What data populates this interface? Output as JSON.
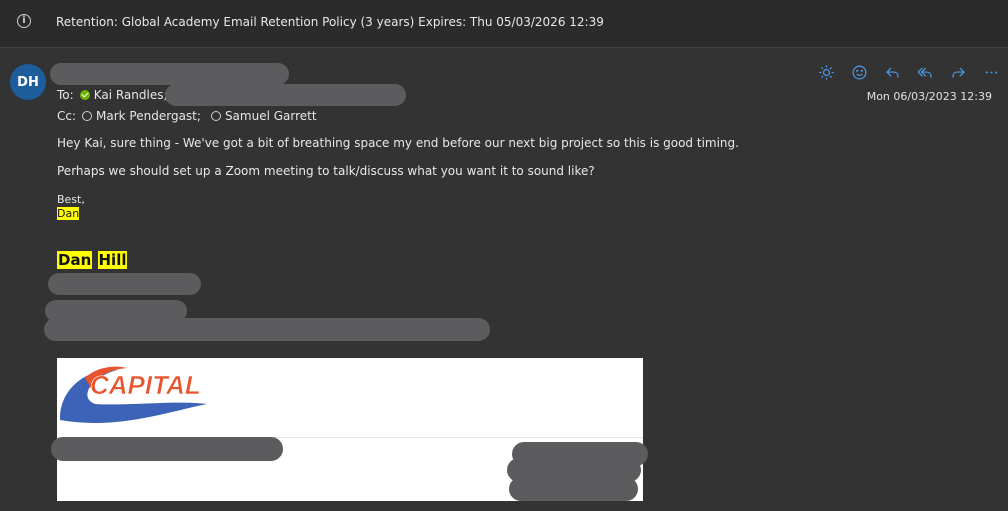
{
  "banner": {
    "icon": "info-icon",
    "text": "Retention: Global Academy Email Retention Policy (3 years) Expires: Thu 05/03/2026 12:39"
  },
  "message": {
    "avatar_initials": "DH",
    "date": "Mon 06/03/2023 12:39",
    "to_label": "To:",
    "to": [
      {
        "name": "Kai Randles;",
        "status": "available"
      }
    ],
    "cc_label": "Cc:",
    "cc": [
      {
        "name": "Mark Pendergast;",
        "status": "offline"
      },
      {
        "name": "Samuel Garrett",
        "status": "offline"
      }
    ],
    "body": {
      "line1": "Hey Kai, sure thing - We've got a bit of breathing space my end before our next big project so this is good timing.",
      "line2": "Perhaps we should set up a Zoom meeting to talk/discuss what you want it to sound like?",
      "closing": "Best,",
      "name": "Dan"
    },
    "signature": {
      "first": "Dan",
      "last": "Hill"
    },
    "logo_text": "CAPITAL"
  },
  "toolbar": {
    "icons": [
      "brightness-icon",
      "emoji-icon",
      "reply-icon",
      "reply-all-icon",
      "forward-icon",
      "more-icon"
    ]
  },
  "colors": {
    "accent": "#4c9be8",
    "avatar": "#1d5d9b",
    "highlight": "#ffff00",
    "logo_red": "#e8542e",
    "logo_blue": "#3d63b8"
  }
}
